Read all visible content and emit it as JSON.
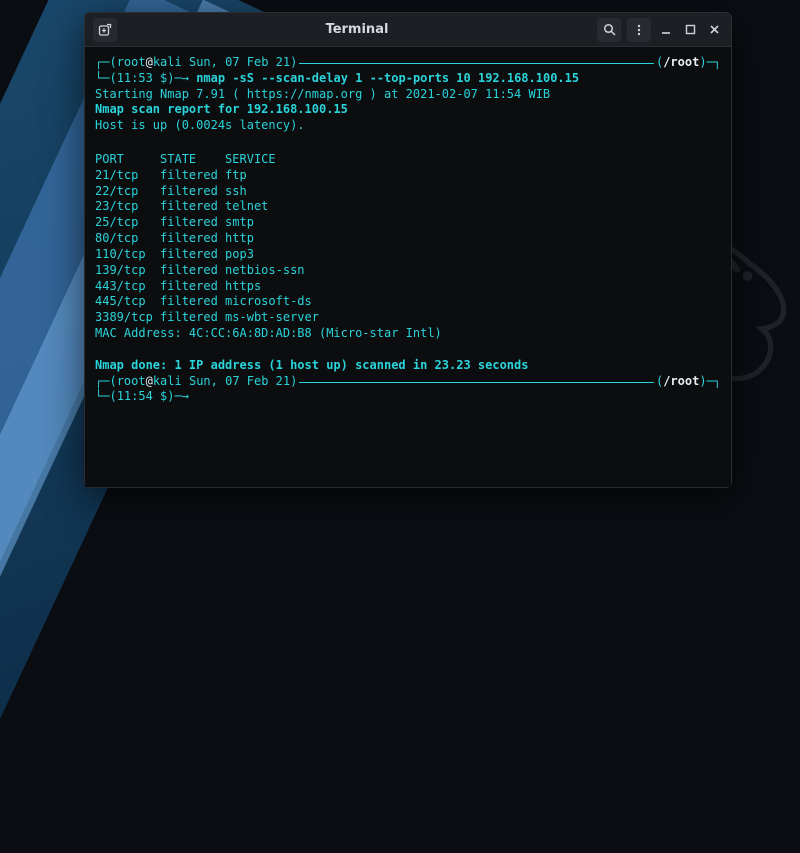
{
  "window": {
    "title": "Terminal"
  },
  "colors": {
    "accent": "#2ad4db",
    "fg": "#e8eef2",
    "bg": "#0b0d0f"
  },
  "prompt1": {
    "user": "root",
    "host": "kali",
    "date": "Sun, 07 Feb 21",
    "cwd": "/root",
    "time": "11:53",
    "currency": "$",
    "arrow": "→",
    "command": "nmap -sS --scan-delay 1 --top-ports 10 192.168.100.15"
  },
  "output": {
    "start": "Starting Nmap 7.91 ( https://nmap.org ) at 2021-02-07 11:54 WIB",
    "report": "Nmap scan report for 192.168.100.15",
    "host": "Host is up (0.0024s latency).",
    "header": {
      "port": "PORT",
      "state": "STATE",
      "service": "SERVICE"
    },
    "rows": [
      {
        "port": "21/tcp",
        "state": "filtered",
        "service": "ftp"
      },
      {
        "port": "22/tcp",
        "state": "filtered",
        "service": "ssh"
      },
      {
        "port": "23/tcp",
        "state": "filtered",
        "service": "telnet"
      },
      {
        "port": "25/tcp",
        "state": "filtered",
        "service": "smtp"
      },
      {
        "port": "80/tcp",
        "state": "filtered",
        "service": "http"
      },
      {
        "port": "110/tcp",
        "state": "filtered",
        "service": "pop3"
      },
      {
        "port": "139/tcp",
        "state": "filtered",
        "service": "netbios-ssn"
      },
      {
        "port": "443/tcp",
        "state": "filtered",
        "service": "https"
      },
      {
        "port": "445/tcp",
        "state": "filtered",
        "service": "microsoft-ds"
      },
      {
        "port": "3389/tcp",
        "state": "filtered",
        "service": "ms-wbt-server"
      }
    ],
    "mac": "MAC Address: 4C:CC:6A:8D:AD:B8 (Micro-star Intl)",
    "done": "Nmap done: 1 IP address (1 host up) scanned in 23.23 seconds"
  },
  "prompt2": {
    "user": "root",
    "host": "kali",
    "date": "Sun, 07 Feb 21",
    "cwd": "/root",
    "time": "11:54",
    "currency": "$",
    "arrow": "→"
  },
  "icons": {
    "new_tab": "new-tab-icon",
    "search": "search-icon",
    "menu": "menu-icon",
    "minimize": "minimize-icon",
    "maximize": "maximize-icon",
    "close": "close-icon"
  }
}
